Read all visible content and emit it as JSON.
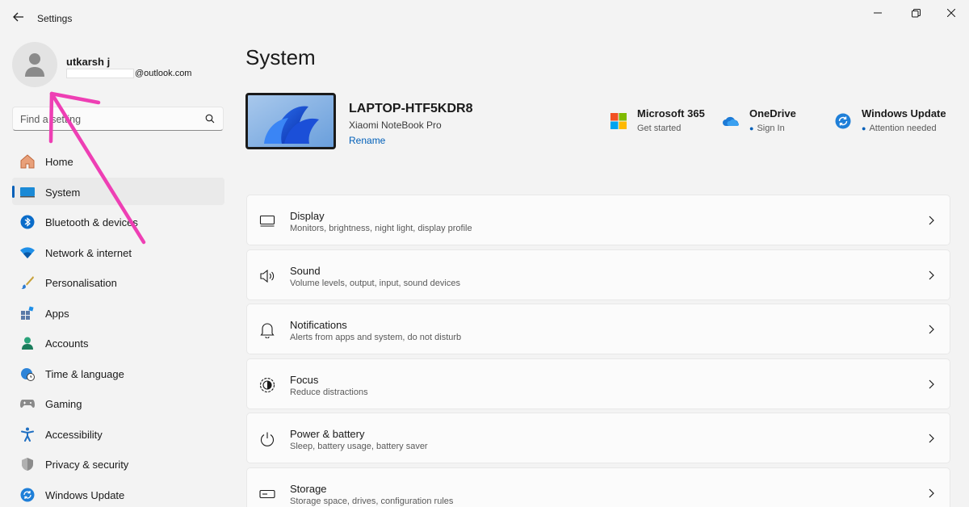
{
  "window": {
    "title": "Settings"
  },
  "profile": {
    "name": "utkarsh j",
    "email_suffix": "@outlook.com"
  },
  "search": {
    "placeholder": "Find a setting"
  },
  "nav": {
    "items": [
      {
        "label": "Home",
        "icon": "home-icon"
      },
      {
        "label": "System",
        "icon": "system-icon"
      },
      {
        "label": "Bluetooth & devices",
        "icon": "bluetooth-icon"
      },
      {
        "label": "Network & internet",
        "icon": "wifi-icon"
      },
      {
        "label": "Personalisation",
        "icon": "brush-icon"
      },
      {
        "label": "Apps",
        "icon": "apps-icon"
      },
      {
        "label": "Accounts",
        "icon": "person-icon"
      },
      {
        "label": "Time & language",
        "icon": "globe-clock-icon"
      },
      {
        "label": "Gaming",
        "icon": "gamepad-icon"
      },
      {
        "label": "Accessibility",
        "icon": "accessibility-icon"
      },
      {
        "label": "Privacy & security",
        "icon": "shield-icon"
      },
      {
        "label": "Windows Update",
        "icon": "update-icon"
      }
    ],
    "active_index": 1
  },
  "main": {
    "title": "System",
    "device": {
      "name": "LAPTOP-HTF5KDR8",
      "model": "Xiaomi NoteBook Pro",
      "rename_label": "Rename"
    },
    "quick_links": [
      {
        "title": "Microsoft 365",
        "subtitle": "Get started",
        "icon": "microsoft-logo-icon"
      },
      {
        "title": "OneDrive",
        "subtitle": "Sign In",
        "icon": "onedrive-cloud-icon"
      },
      {
        "title": "Windows Update",
        "subtitle": "Attention needed",
        "icon": "windows-update-icon"
      }
    ],
    "cards": [
      {
        "title": "Display",
        "subtitle": "Monitors, brightness, night light, display profile",
        "icon": "monitor-icon"
      },
      {
        "title": "Sound",
        "subtitle": "Volume levels, output, input, sound devices",
        "icon": "speaker-icon"
      },
      {
        "title": "Notifications",
        "subtitle": "Alerts from apps and system, do not disturb",
        "icon": "bell-icon"
      },
      {
        "title": "Focus",
        "subtitle": "Reduce distractions",
        "icon": "focus-icon"
      },
      {
        "title": "Power & battery",
        "subtitle": "Sleep, battery usage, battery saver",
        "icon": "power-icon"
      },
      {
        "title": "Storage",
        "subtitle": "Storage space, drives, configuration rules",
        "icon": "storage-icon"
      }
    ]
  },
  "colors": {
    "accent": "#005fb8",
    "annotation": "#ee3fb4"
  }
}
